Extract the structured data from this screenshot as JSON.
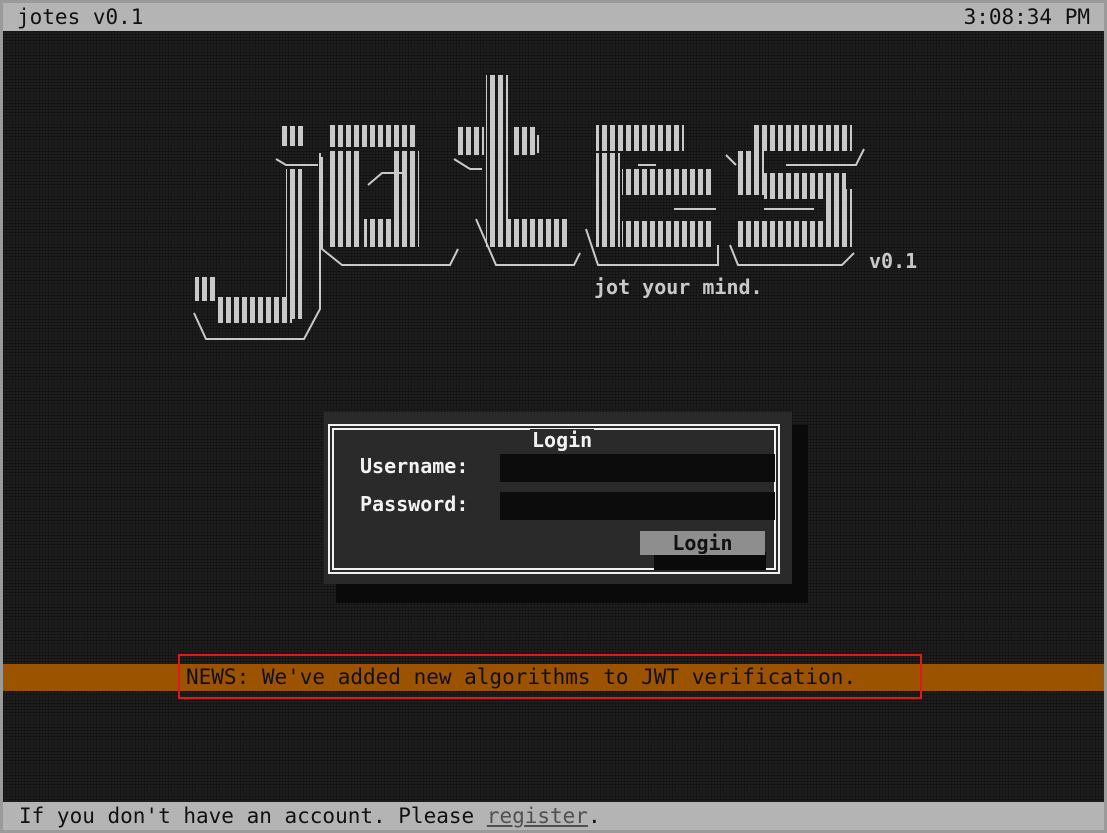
{
  "topbar": {
    "app_title": "jotes v0.1",
    "clock": "3:08:34 PM"
  },
  "logo": {
    "wordmark": "jotes",
    "version": "v0.1",
    "tagline": "jot your mind."
  },
  "login": {
    "title": "Login",
    "username_label": "Username:",
    "username_value": "",
    "password_label": "Password:",
    "password_value": "",
    "button_label": "Login"
  },
  "news": {
    "text": "NEWS: We've added new algorithms to JWT verification."
  },
  "footer": {
    "message_before": "If you don't have an account. Please ",
    "register_link": "register",
    "message_after": "."
  },
  "colors": {
    "background": "#1e1e1e",
    "bars": "#b4b4b4",
    "news_bar": "#9c5300",
    "highlight": "#e01818"
  }
}
